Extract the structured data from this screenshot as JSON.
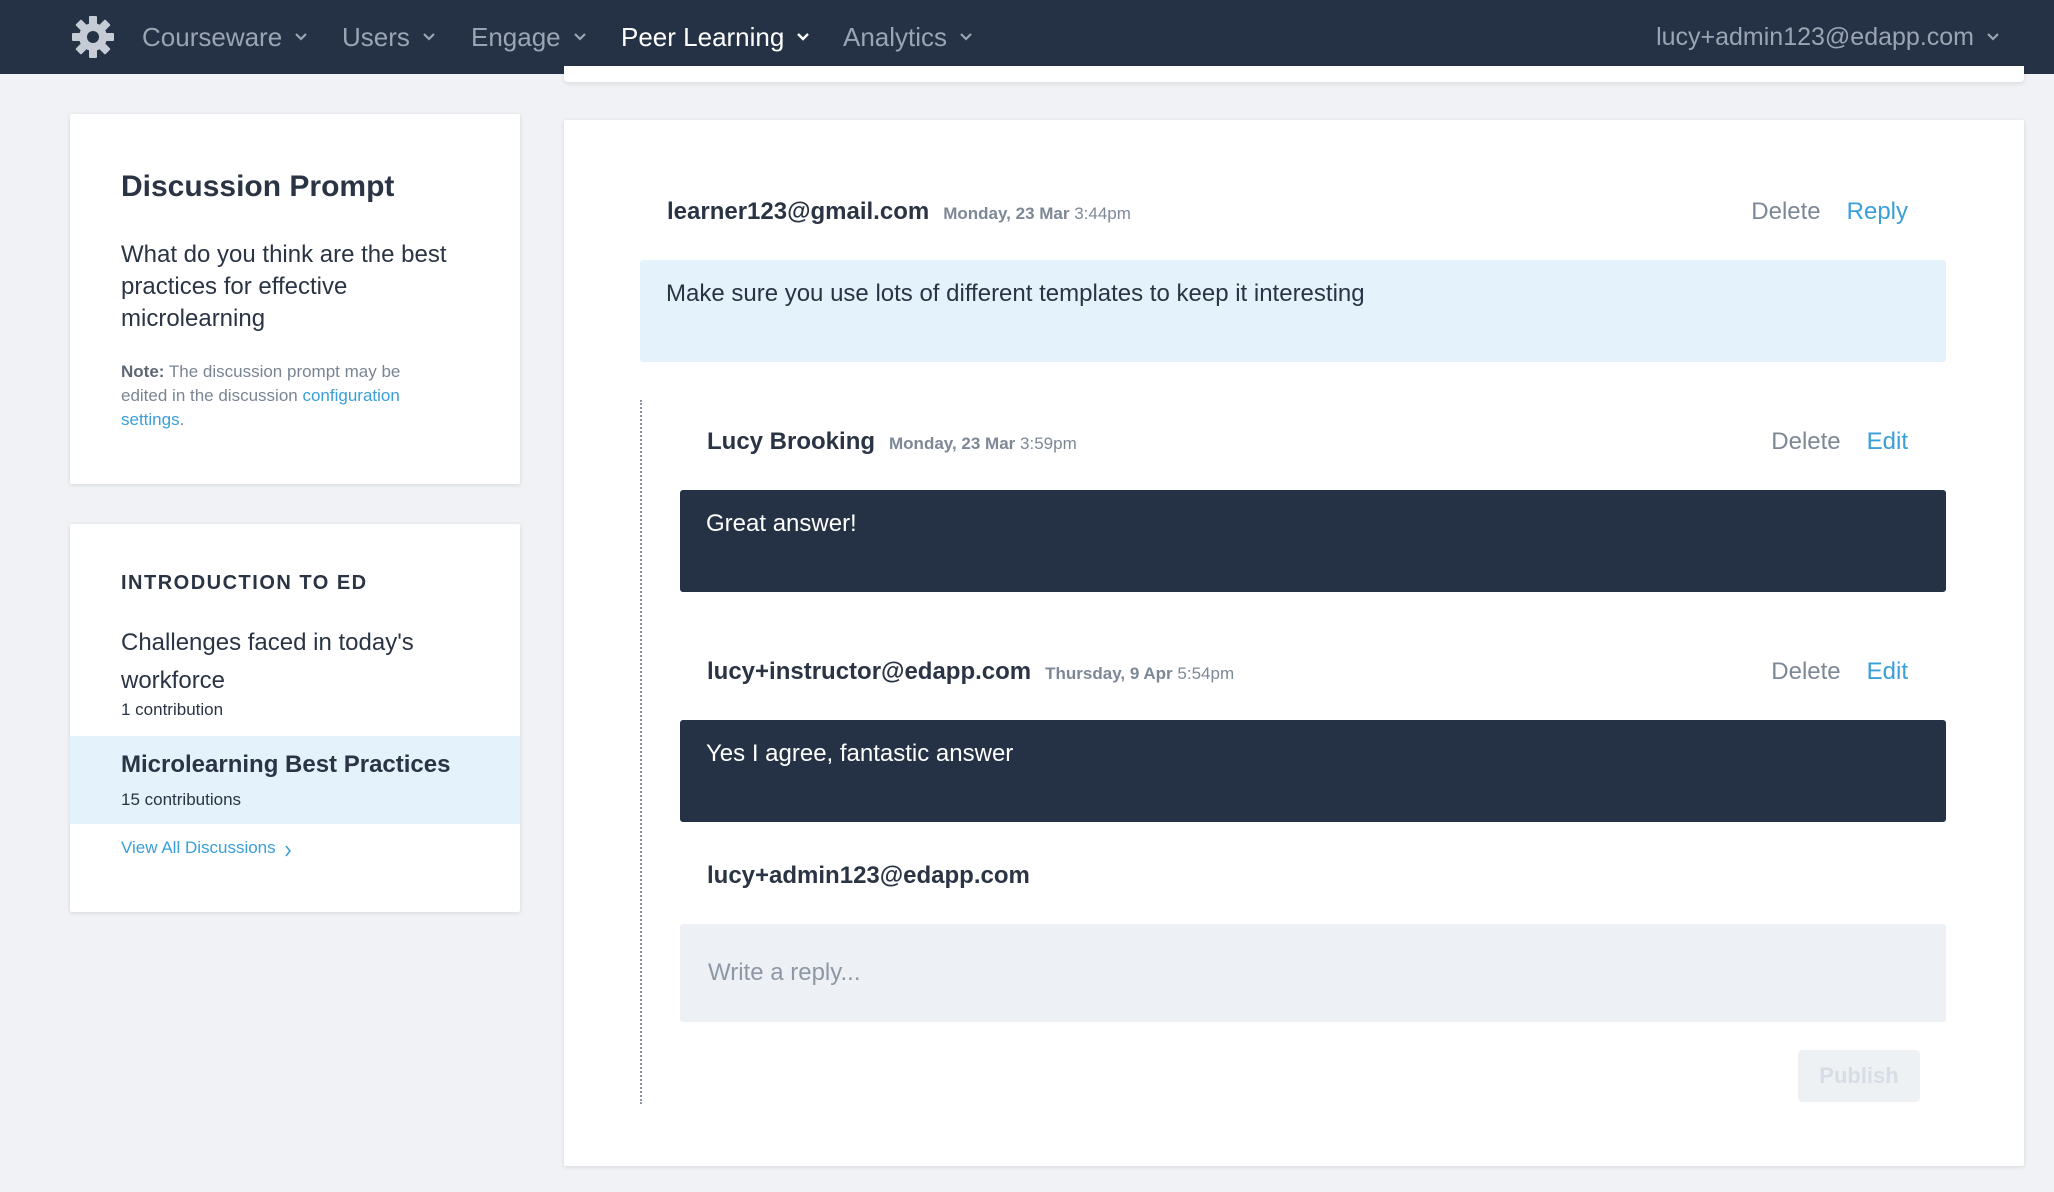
{
  "nav": {
    "items": [
      {
        "label": "Courseware",
        "active": false
      },
      {
        "label": "Users",
        "active": false
      },
      {
        "label": "Engage",
        "active": false
      },
      {
        "label": "Peer Learning",
        "active": true
      },
      {
        "label": "Analytics",
        "active": false
      }
    ],
    "account": "lucy+admin123@edapp.com",
    "logo_icon": "gear-icon"
  },
  "prompt": {
    "title": "Discussion Prompt",
    "text": "What do you think are the best practices for effective microlearning",
    "note_label": "Note:",
    "note_text": "The discussion prompt may be edited in the discussion",
    "note_link": "configuration settings",
    "note_end": "."
  },
  "sidebar": {
    "heading": "INTRODUCTION TO ED",
    "discussions": [
      {
        "title": "Challenges faced in today's workforce",
        "count": "1 contribution",
        "selected": false
      },
      {
        "title": "Microlearning Best Practices",
        "count": "15 contributions",
        "selected": true
      }
    ],
    "view_all": "View All Discussions"
  },
  "thread": {
    "post": {
      "author": "learner123@gmail.com",
      "date": "Monday, 23 Mar",
      "time": "3:44pm",
      "delete": "Delete",
      "action": "Reply",
      "body": "Make sure you use lots of different templates to keep it interesting"
    },
    "replies": [
      {
        "author": "Lucy Brooking",
        "date": "Monday, 23 Mar",
        "time": "3:59pm",
        "delete": "Delete",
        "action": "Edit",
        "body": "Great answer!"
      },
      {
        "author": "lucy+instructor@edapp.com",
        "date": "Thursday, 9 Apr",
        "time": "5:54pm",
        "delete": "Delete",
        "action": "Edit",
        "body": "Yes I agree, fantastic answer"
      }
    ],
    "composer": {
      "author": "lucy+admin123@edapp.com",
      "placeholder": "Write a reply...",
      "value": "",
      "publish": "Publish"
    }
  },
  "colors": {
    "nav_bg": "#253245",
    "accent": "#3a9fd8",
    "highlight": "#e3f2fb",
    "dark_bubble": "#253245"
  }
}
